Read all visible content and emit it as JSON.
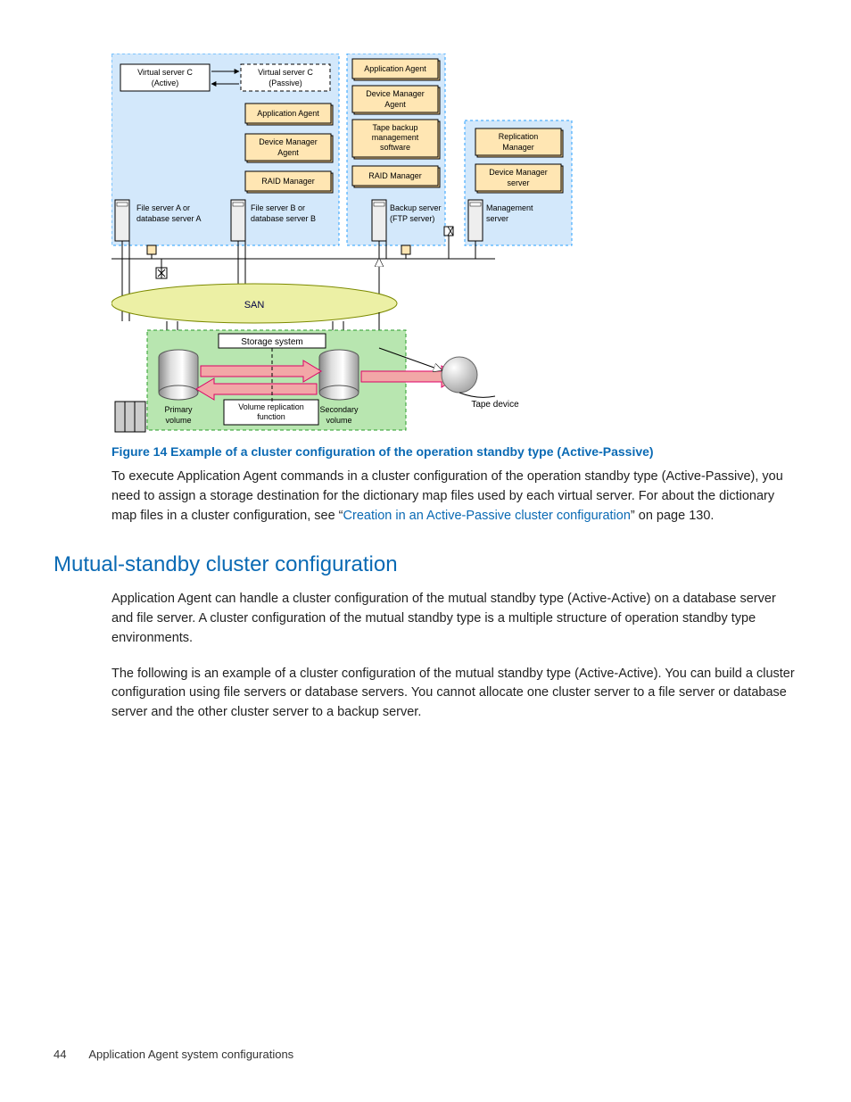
{
  "diagram": {
    "cluster1": {
      "virtual_active_l1": "Virtual server C",
      "virtual_active_l2": "(Active)",
      "virtual_passive_l1": "Virtual server C",
      "virtual_passive_l2": "(Passive)",
      "app_agent": "Application Agent",
      "dev_mgr_l1": "Device Manager",
      "dev_mgr_l2": "Agent",
      "raid_mgr": "RAID Manager",
      "server_a_l1": "File server A or",
      "server_a_l2": "database server A",
      "server_b_l1": "File server B or",
      "server_b_l2": "database server B"
    },
    "backup": {
      "app_agent": "Application Agent",
      "dev_mgr_l1": "Device Manager",
      "dev_mgr_l2": "Agent",
      "tape_l1": "Tape backup",
      "tape_l2": "management",
      "tape_l3": "software",
      "raid_mgr": "RAID Manager",
      "server_l1": "Backup server",
      "server_l2": "(FTP server)"
    },
    "mgmt": {
      "rep_l1": "Replication",
      "rep_l2": "Manager",
      "dev_l1": "Device Manager",
      "dev_l2": "server",
      "server_l1": "Management",
      "server_l2": "server"
    },
    "san": "SAN",
    "storage": {
      "title": "Storage system",
      "primary_l1": "Primary",
      "primary_l2": "volume",
      "replication_l1": "Volume replication",
      "replication_l2": "function",
      "secondary_l1": "Secondary",
      "secondary_l2": "volume"
    },
    "tape_device": "Tape device"
  },
  "figure_caption": "Figure 14 Example of a cluster configuration of the operation standby type (Active-Passive)",
  "para1_a": "To execute Application Agent commands in a cluster configuration of the operation standby type (Active-Passive), you need to assign a storage destination for the dictionary map files used by each virtual server. For about the dictionary map files in a cluster configuration, see “",
  "para1_link": "Creation in an Active-Passive cluster configuration",
  "para1_b": "” on page 130.",
  "section_heading": "Mutual-standby cluster configuration",
  "para2": "Application Agent can handle a cluster configuration of the mutual standby type (Active-Active) on a database server and file server. A cluster configuration of the mutual standby type is a multiple structure of operation standby type environments.",
  "para3": "The following is an example of a cluster configuration of the mutual standby type (Active-Active). You can build a cluster configuration using file servers or database servers. You cannot allocate one cluster server to a file server or database server and the other cluster server to a backup server.",
  "footer": {
    "page_number": "44",
    "title": "Application Agent system configurations"
  }
}
